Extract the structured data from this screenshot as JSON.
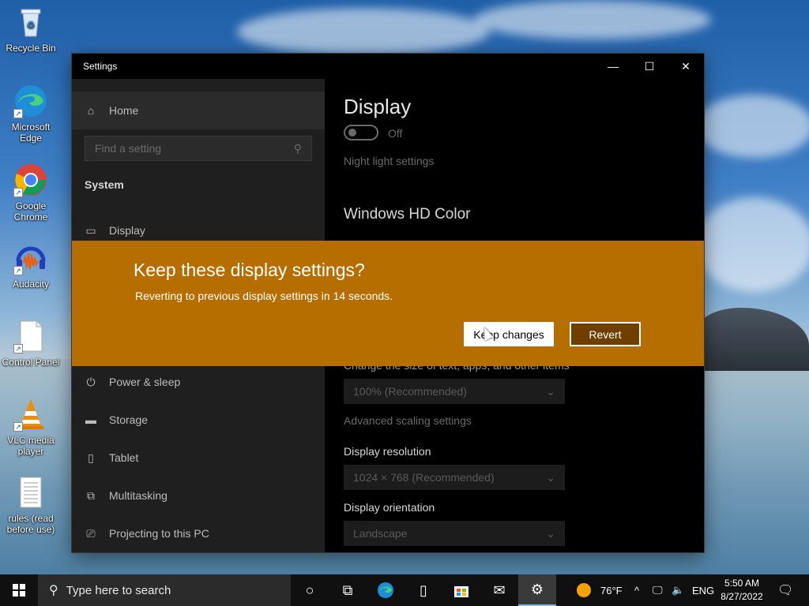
{
  "desktop": {
    "icons": [
      {
        "label": "Recycle Bin",
        "icon": "recycle-bin-icon"
      },
      {
        "label": "Microsoft Edge",
        "icon": "edge-icon"
      },
      {
        "label": "Google Chrome",
        "icon": "chrome-icon"
      },
      {
        "label": "Audacity",
        "icon": "audacity-icon"
      },
      {
        "label": "Control Panel",
        "icon": "document-icon"
      },
      {
        "label": "VLC media player",
        "icon": "vlc-icon"
      },
      {
        "label": "rules (read before use)",
        "icon": "text-file-icon"
      }
    ]
  },
  "window": {
    "title": "Settings",
    "controls": {
      "minimize": "—",
      "maximize": "☐",
      "close": "✕"
    }
  },
  "sidebar": {
    "home": "Home",
    "search_placeholder": "Find a setting",
    "section": "System",
    "items": [
      {
        "label": "Display",
        "icon": "monitor-icon"
      },
      {
        "label": "Power & sleep",
        "icon": "power-icon"
      },
      {
        "label": "Storage",
        "icon": "storage-icon"
      },
      {
        "label": "Tablet",
        "icon": "tablet-icon"
      },
      {
        "label": "Multitasking",
        "icon": "multitasking-icon"
      },
      {
        "label": "Projecting to this PC",
        "icon": "projector-icon"
      }
    ]
  },
  "main": {
    "title": "Display",
    "toggle_state": "Off",
    "night_light_link": "Night light settings",
    "hd_color_heading": "Windows HD Color",
    "scale_label": "Change the size of text, apps, and other items",
    "scale_value": "100% (Recommended)",
    "advanced_scaling": "Advanced scaling settings",
    "resolution_label": "Display resolution",
    "resolution_value": "1024 × 768 (Recommended)",
    "orientation_label": "Display orientation",
    "orientation_value": "Landscape"
  },
  "dialog": {
    "title": "Keep these display settings?",
    "message": "Reverting to previous display settings in 14 seconds.",
    "keep_label": "Keep changes",
    "revert_label": "Revert",
    "background_color": "#b76e00"
  },
  "taskbar": {
    "search_placeholder": "Type here to search",
    "weather_temp": "76°F",
    "language": "ENG",
    "time": "5:50 AM",
    "date": "8/27/2022",
    "apps": [
      "cortana-icon",
      "task-view-icon",
      "edge-icon",
      "file-icon",
      "store-icon",
      "mail-icon",
      "settings-icon"
    ]
  }
}
